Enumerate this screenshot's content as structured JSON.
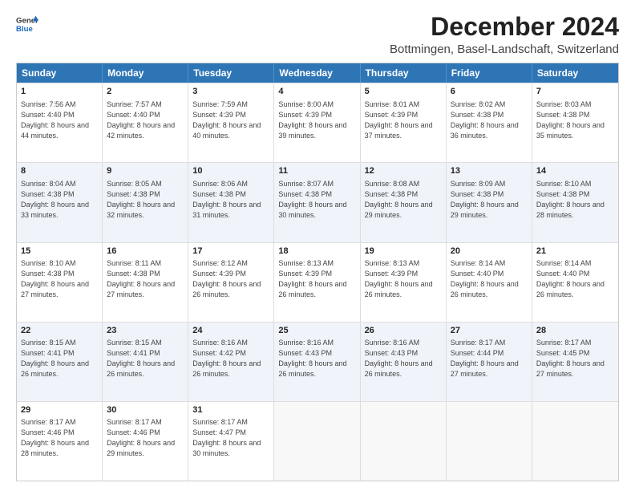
{
  "logo": {
    "general": "General",
    "blue": "Blue"
  },
  "header": {
    "title": "December 2024",
    "subtitle": "Bottmingen, Basel-Landschaft, Switzerland"
  },
  "days": [
    "Sunday",
    "Monday",
    "Tuesday",
    "Wednesday",
    "Thursday",
    "Friday",
    "Saturday"
  ],
  "weeks": [
    {
      "alt": false,
      "cells": [
        {
          "day": "1",
          "sunrise": "7:56 AM",
          "sunset": "4:40 PM",
          "daylight": "8 hours and 44 minutes."
        },
        {
          "day": "2",
          "sunrise": "7:57 AM",
          "sunset": "4:40 PM",
          "daylight": "8 hours and 42 minutes."
        },
        {
          "day": "3",
          "sunrise": "7:59 AM",
          "sunset": "4:39 PM",
          "daylight": "8 hours and 40 minutes."
        },
        {
          "day": "4",
          "sunrise": "8:00 AM",
          "sunset": "4:39 PM",
          "daylight": "8 hours and 39 minutes."
        },
        {
          "day": "5",
          "sunrise": "8:01 AM",
          "sunset": "4:39 PM",
          "daylight": "8 hours and 37 minutes."
        },
        {
          "day": "6",
          "sunrise": "8:02 AM",
          "sunset": "4:38 PM",
          "daylight": "8 hours and 36 minutes."
        },
        {
          "day": "7",
          "sunrise": "8:03 AM",
          "sunset": "4:38 PM",
          "daylight": "8 hours and 35 minutes."
        }
      ]
    },
    {
      "alt": true,
      "cells": [
        {
          "day": "8",
          "sunrise": "8:04 AM",
          "sunset": "4:38 PM",
          "daylight": "8 hours and 33 minutes."
        },
        {
          "day": "9",
          "sunrise": "8:05 AM",
          "sunset": "4:38 PM",
          "daylight": "8 hours and 32 minutes."
        },
        {
          "day": "10",
          "sunrise": "8:06 AM",
          "sunset": "4:38 PM",
          "daylight": "8 hours and 31 minutes."
        },
        {
          "day": "11",
          "sunrise": "8:07 AM",
          "sunset": "4:38 PM",
          "daylight": "8 hours and 30 minutes."
        },
        {
          "day": "12",
          "sunrise": "8:08 AM",
          "sunset": "4:38 PM",
          "daylight": "8 hours and 29 minutes."
        },
        {
          "day": "13",
          "sunrise": "8:09 AM",
          "sunset": "4:38 PM",
          "daylight": "8 hours and 29 minutes."
        },
        {
          "day": "14",
          "sunrise": "8:10 AM",
          "sunset": "4:38 PM",
          "daylight": "8 hours and 28 minutes."
        }
      ]
    },
    {
      "alt": false,
      "cells": [
        {
          "day": "15",
          "sunrise": "8:10 AM",
          "sunset": "4:38 PM",
          "daylight": "8 hours and 27 minutes."
        },
        {
          "day": "16",
          "sunrise": "8:11 AM",
          "sunset": "4:38 PM",
          "daylight": "8 hours and 27 minutes."
        },
        {
          "day": "17",
          "sunrise": "8:12 AM",
          "sunset": "4:39 PM",
          "daylight": "8 hours and 26 minutes."
        },
        {
          "day": "18",
          "sunrise": "8:13 AM",
          "sunset": "4:39 PM",
          "daylight": "8 hours and 26 minutes."
        },
        {
          "day": "19",
          "sunrise": "8:13 AM",
          "sunset": "4:39 PM",
          "daylight": "8 hours and 26 minutes."
        },
        {
          "day": "20",
          "sunrise": "8:14 AM",
          "sunset": "4:40 PM",
          "daylight": "8 hours and 26 minutes."
        },
        {
          "day": "21",
          "sunrise": "8:14 AM",
          "sunset": "4:40 PM",
          "daylight": "8 hours and 26 minutes."
        }
      ]
    },
    {
      "alt": true,
      "cells": [
        {
          "day": "22",
          "sunrise": "8:15 AM",
          "sunset": "4:41 PM",
          "daylight": "8 hours and 26 minutes."
        },
        {
          "day": "23",
          "sunrise": "8:15 AM",
          "sunset": "4:41 PM",
          "daylight": "8 hours and 26 minutes."
        },
        {
          "day": "24",
          "sunrise": "8:16 AM",
          "sunset": "4:42 PM",
          "daylight": "8 hours and 26 minutes."
        },
        {
          "day": "25",
          "sunrise": "8:16 AM",
          "sunset": "4:43 PM",
          "daylight": "8 hours and 26 minutes."
        },
        {
          "day": "26",
          "sunrise": "8:16 AM",
          "sunset": "4:43 PM",
          "daylight": "8 hours and 26 minutes."
        },
        {
          "day": "27",
          "sunrise": "8:17 AM",
          "sunset": "4:44 PM",
          "daylight": "8 hours and 27 minutes."
        },
        {
          "day": "28",
          "sunrise": "8:17 AM",
          "sunset": "4:45 PM",
          "daylight": "8 hours and 27 minutes."
        }
      ]
    },
    {
      "alt": false,
      "cells": [
        {
          "day": "29",
          "sunrise": "8:17 AM",
          "sunset": "4:46 PM",
          "daylight": "8 hours and 28 minutes."
        },
        {
          "day": "30",
          "sunrise": "8:17 AM",
          "sunset": "4:46 PM",
          "daylight": "8 hours and 29 minutes."
        },
        {
          "day": "31",
          "sunrise": "8:17 AM",
          "sunset": "4:47 PM",
          "daylight": "8 hours and 30 minutes."
        },
        {
          "day": "",
          "sunrise": "",
          "sunset": "",
          "daylight": ""
        },
        {
          "day": "",
          "sunrise": "",
          "sunset": "",
          "daylight": ""
        },
        {
          "day": "",
          "sunrise": "",
          "sunset": "",
          "daylight": ""
        },
        {
          "day": "",
          "sunrise": "",
          "sunset": "",
          "daylight": ""
        }
      ]
    }
  ],
  "labels": {
    "sunrise": "Sunrise:",
    "sunset": "Sunset:",
    "daylight": "Daylight:"
  }
}
